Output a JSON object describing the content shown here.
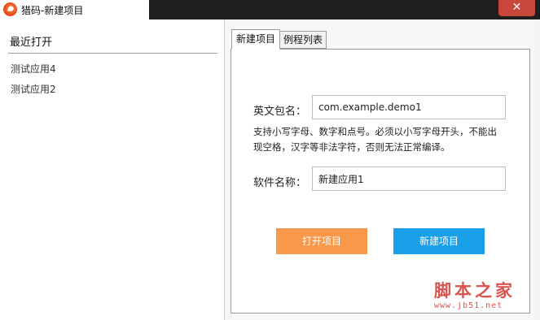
{
  "window": {
    "title": "猎码-新建项目",
    "close_glyph": "✕"
  },
  "recent": {
    "title": "最近打开",
    "items": [
      "测试应用4",
      "测试应用2"
    ]
  },
  "tabs": [
    {
      "label": "新建项目",
      "active": true
    },
    {
      "label": "例程列表",
      "active": false
    }
  ],
  "form": {
    "package_label": "英文包名：",
    "package_value": "com.example.demo1",
    "hint_line1": "支持小写字母、数字和点号。必须以小写字母开头，不能出",
    "hint_line2": "现空格，汉字等非法字符，否则无法正常编译。",
    "name_label": "软件名称：",
    "name_value": "新建应用1"
  },
  "buttons": {
    "open": "打开项目",
    "create": "新建项目"
  },
  "watermark": {
    "text": "脚本之家",
    "url": "www.jb51.net"
  },
  "colors": {
    "open_button": "#f7984b",
    "create_button": "#1aa0e8",
    "close_button": "#c7473b"
  }
}
